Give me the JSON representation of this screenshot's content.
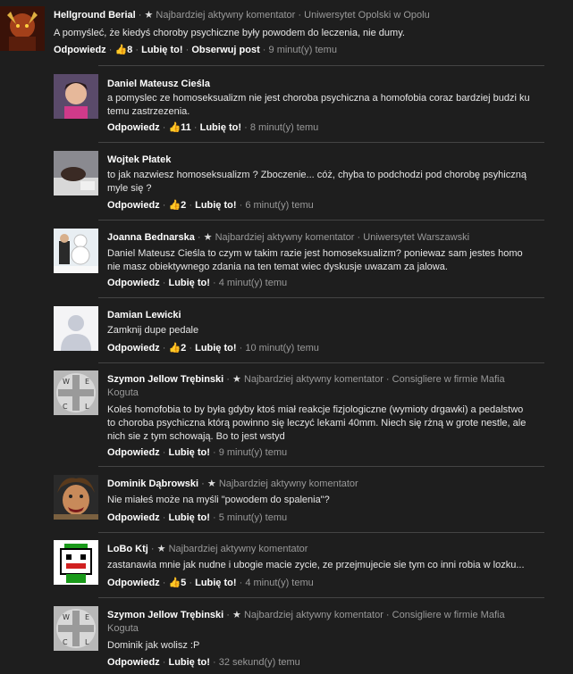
{
  "comments": [
    {
      "author": "Hellground Berial",
      "badge": "Najbardziej aktywny komentator",
      "affiliation": "Uniwersytet Opolski w Opolu",
      "text": "A pomyśleć, że kiedyś choroby psychiczne były powodem do leczenia, nie dumy.",
      "reply": "Odpowiedz",
      "likes": "8",
      "like": "Lubię to!",
      "follow": "Obserwuj post",
      "time": "9 minut(y) temu"
    },
    {
      "author": "Daniel Mateusz Cieśla",
      "text1": "a pomyslec ze homoseksualizm nie jest choroba psychiczna a homofobia coraz bardziej budzi ku",
      "text2": "temu zastrzezenia.",
      "reply": "Odpowiedz",
      "likes": "11",
      "like": "Lubię to!",
      "time": "8 minut(y) temu"
    },
    {
      "author": "Wojtek Płatek",
      "text1": "to jak nazwiesz homoseksualizm ? Zboczenie... cóż, chyba to podchodzi pod chorobę psyhiczną",
      "text2": "myle się ?",
      "reply": "Odpowiedz",
      "likes": "2",
      "like": "Lubię to!",
      "time": "6 minut(y) temu"
    },
    {
      "author": "Joanna Bednarska",
      "badge": "Najbardziej aktywny komentator",
      "affiliation": "Uniwersytet Warszawski",
      "text1": "Daniel Mateusz Cieśla to czym w takim razie jest homoseksualizm? poniewaz sam jestes homo",
      "text2": "nie masz obiektywnego zdania na ten temat wiec dyskusje uwazam za jalowa.",
      "reply": "Odpowiedz",
      "like": "Lubię to!",
      "time": "4 minut(y) temu"
    },
    {
      "author": "Damian Lewicki",
      "text": "Zamknij dupe pedale",
      "reply": "Odpowiedz",
      "likes": "2",
      "like": "Lubię to!",
      "time": "10 minut(y) temu"
    },
    {
      "author": "Szymon Jellow Trębinski",
      "badge": "Najbardziej aktywny komentator",
      "affiliation1": "Consigliere w firmie Mafia",
      "affiliation2": "Koguta",
      "text1": "Koleś homofobia to by była gdyby ktoś miał reakcje fizjologiczne (wymioty drgawki) a pedalstwo",
      "text2": "to choroba psychiczna którą powinno się leczyć lekami 40mm. Niech się rżną w grote nestle, ale",
      "text3": "nich sie z tym schowają. Bo to jest wstyd",
      "reply": "Odpowiedz",
      "like": "Lubię to!",
      "time": "9 minut(y) temu"
    },
    {
      "author": "Dominik Dąbrowski",
      "badge": "Najbardziej aktywny komentator",
      "text": "Nie miałeś może na myśli \"powodem do spalenia\"?",
      "reply": "Odpowiedz",
      "like": "Lubię to!",
      "time": "5 minut(y) temu"
    },
    {
      "author": "LoBo Ktj",
      "badge": "Najbardziej aktywny komentator",
      "text": "zastanawia mnie jak nudne i ubogie macie zycie, ze przejmujecie sie tym co inni robia w lozku...",
      "reply": "Odpowiedz",
      "likes": "5",
      "like": "Lubię to!",
      "time": "4 minut(y) temu"
    },
    {
      "author": "Szymon Jellow Trębinski",
      "badge": "Najbardziej aktywny komentator",
      "affiliation1": "Consigliere w firmie Mafia",
      "affiliation2": "Koguta",
      "text": "Dominik jak wolisz :P",
      "reply": "Odpowiedz",
      "like": "Lubię to!",
      "time": "32 sekund(y) temu"
    }
  ],
  "icons": {
    "star": "star-icon",
    "thumb": "thumbs-up-icon"
  }
}
